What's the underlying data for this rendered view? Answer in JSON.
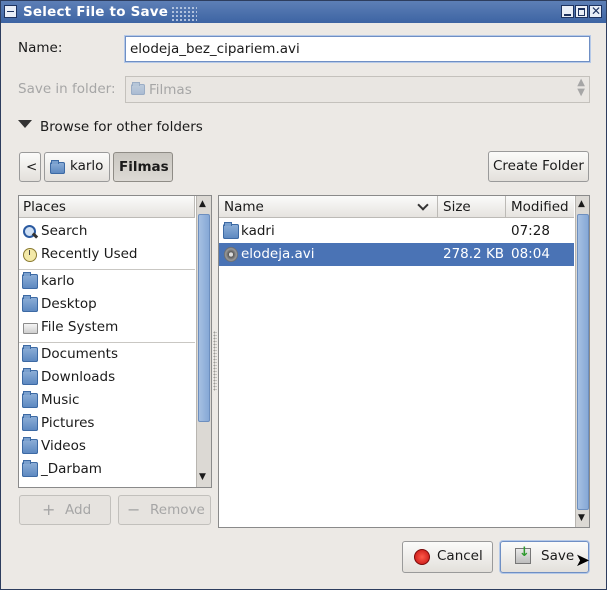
{
  "window": {
    "title": "Select File to Save"
  },
  "name_field": {
    "label": "Name:",
    "value": "elodeja_bez_cipariem.avi"
  },
  "save_in": {
    "label": "Save in folder:",
    "value": "Filmas"
  },
  "browse": {
    "label": "Browse for other folders"
  },
  "path_bar": {
    "back": "<",
    "crumbs": [
      "karlo",
      "Filmas"
    ]
  },
  "create_folder": {
    "label": "Create Folder"
  },
  "places": {
    "header": "Places",
    "items": [
      {
        "label": "Search",
        "icon": "search-icon"
      },
      {
        "label": "Recently Used",
        "icon": "recent-icon"
      },
      {
        "label": "karlo",
        "icon": "home-folder-icon"
      },
      {
        "label": "Desktop",
        "icon": "desktop-folder-icon"
      },
      {
        "label": "File System",
        "icon": "drive-icon"
      },
      {
        "label": "Documents",
        "icon": "documents-folder-icon"
      },
      {
        "label": "Downloads",
        "icon": "downloads-folder-icon"
      },
      {
        "label": "Music",
        "icon": "music-folder-icon"
      },
      {
        "label": "Pictures",
        "icon": "pictures-folder-icon"
      },
      {
        "label": "Videos",
        "icon": "videos-folder-icon"
      },
      {
        "label": "_Darbam",
        "icon": "folder-icon"
      }
    ],
    "add_label": "Add",
    "remove_label": "Remove"
  },
  "files": {
    "columns": {
      "name": "Name",
      "size": "Size",
      "modified": "Modified"
    },
    "rows": [
      {
        "name": "kadri",
        "size": "",
        "modified": "07:28",
        "icon": "folder-icon"
      },
      {
        "name": "elodeja.avi",
        "size": "278.2 KB",
        "modified": "08:04",
        "icon": "video-file-icon"
      }
    ]
  },
  "actions": {
    "cancel": "Cancel",
    "save": "Save"
  },
  "colors": {
    "selection": "#4a73b5",
    "titlebar": "#4a6faa",
    "accent": "#89aad8"
  }
}
